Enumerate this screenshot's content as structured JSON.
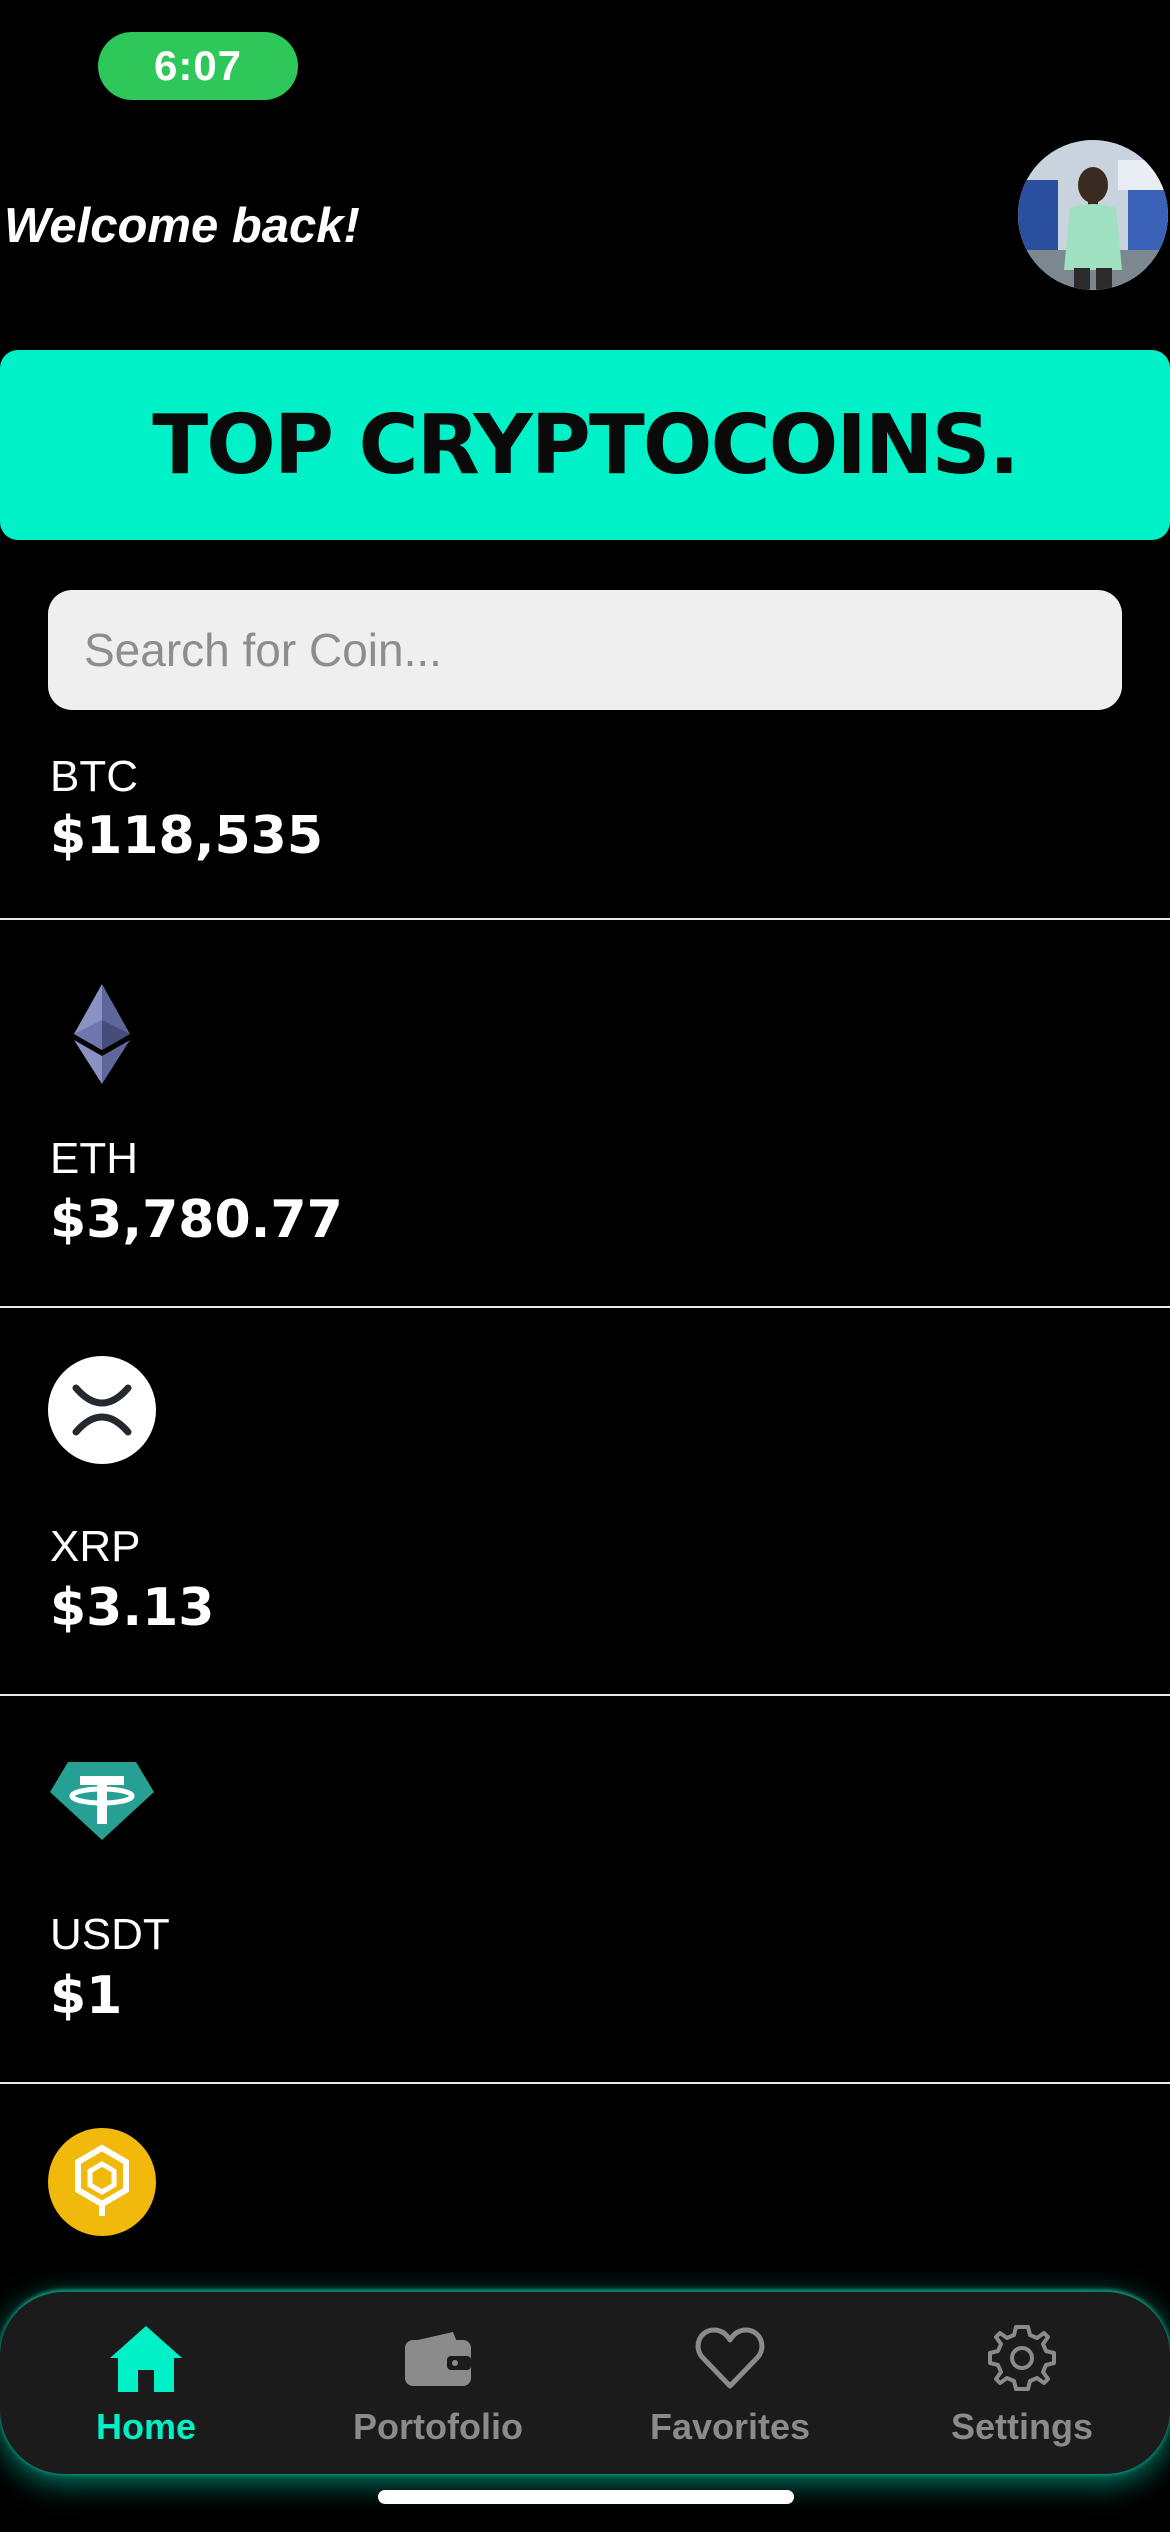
{
  "status_bar": {
    "time": "6:07"
  },
  "header": {
    "welcome_text": "Welcome back!"
  },
  "banner": {
    "title": "TOP CRYPTOCOINS."
  },
  "search": {
    "placeholder": "Search for Coin..."
  },
  "coins": [
    {
      "symbol": "BTC",
      "price": "$118,535",
      "icon": "bitcoin-icon"
    },
    {
      "symbol": "ETH",
      "price": "$3,780.77",
      "icon": "ethereum-icon"
    },
    {
      "symbol": "XRP",
      "price": "$3.13",
      "icon": "xrp-icon"
    },
    {
      "symbol": "USDT",
      "price": "$1",
      "icon": "tether-icon"
    },
    {
      "symbol": "",
      "price": "",
      "icon": "bnb-icon"
    }
  ],
  "tabs": [
    {
      "label": "Home",
      "icon": "home-icon",
      "active": true
    },
    {
      "label": "Portofolio",
      "icon": "wallet-icon",
      "active": false
    },
    {
      "label": "Favorites",
      "icon": "heart-icon",
      "active": false
    },
    {
      "label": "Settings",
      "icon": "gear-icon",
      "active": false
    }
  ],
  "colors": {
    "accent": "#00f0c8",
    "background": "#000000",
    "status_pill": "#2ec85a",
    "tab_inactive": "#8b8b8b",
    "tabbar_bg": "#1b1b1b"
  }
}
